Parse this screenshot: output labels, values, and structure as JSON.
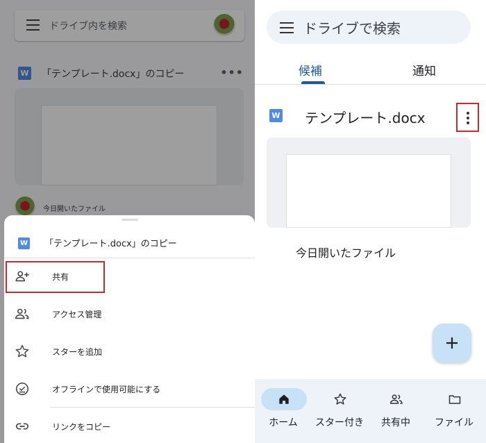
{
  "left": {
    "search_placeholder": "ドライブ内を検索",
    "file_title": "「テンプレート.docx」のコピー",
    "file_type_badge": "W",
    "more_glyph": "•••",
    "recent_label": "今日開いたファイル",
    "sheet": {
      "title": "「テンプレート.docx」のコピー",
      "file_type_badge": "W",
      "items": [
        {
          "label": "共有",
          "icon": "person-add-icon"
        },
        {
          "label": "アクセス管理",
          "icon": "people-icon"
        },
        {
          "label": "スターを追加",
          "icon": "star-icon"
        },
        {
          "label": "オフラインで使用可能にする",
          "icon": "offline-check-icon"
        },
        {
          "label": "リンクをコピー",
          "icon": "link-icon"
        }
      ]
    }
  },
  "right": {
    "search_placeholder": "ドライブで検索",
    "tabs": [
      {
        "label": "候補",
        "active": true
      },
      {
        "label": "通知",
        "active": false
      }
    ],
    "file_title": "テンプレート.docx",
    "file_type_badge": "W",
    "recent_label": "今日開いたファイル",
    "bottom_nav": [
      {
        "label": "ホーム",
        "icon": "home-icon",
        "active": true
      },
      {
        "label": "スター付き",
        "icon": "star-icon",
        "active": false
      },
      {
        "label": "共有中",
        "icon": "people-icon",
        "active": false
      },
      {
        "label": "ファイル",
        "icon": "folder-icon",
        "active": false
      }
    ]
  },
  "colors": {
    "accent_blue": "#1a56b0",
    "highlight_red": "#d0262d",
    "fab_background": "#c7e2f7",
    "word_icon": "#4f8be4"
  }
}
